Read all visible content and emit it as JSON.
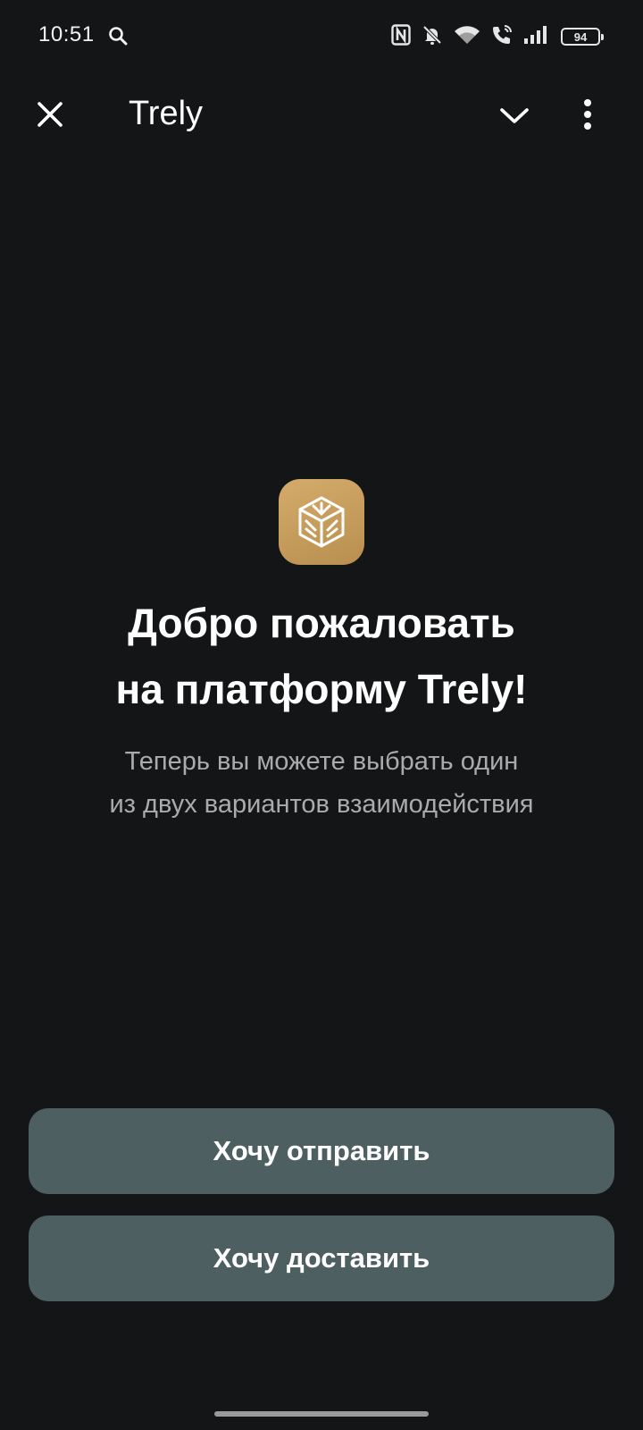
{
  "status_bar": {
    "time": "10:51",
    "battery_level": "94",
    "icons": [
      "search-icon",
      "nfc-icon",
      "bell-off-icon",
      "wifi-icon",
      "wifi-call-icon",
      "signal-icon",
      "battery-icon"
    ]
  },
  "app_bar": {
    "title": "Trely",
    "icons": [
      "close-icon",
      "chevron-down-icon",
      "more-vert-icon"
    ]
  },
  "content": {
    "logo_icon": "trely-logo-icon",
    "title_line1": "Добро пожаловать",
    "title_line2": "на платформу Trely!",
    "subtitle_line1": "Теперь вы можете выбрать один",
    "subtitle_line2": "из двух вариантов взаимодействия"
  },
  "actions": {
    "send_label": "Хочу отправить",
    "deliver_label": "Хочу доставить"
  },
  "colors": {
    "background": "#131517",
    "button": "#4d5f61",
    "logo": "#c9a061",
    "subtitle": "#a9abad"
  }
}
